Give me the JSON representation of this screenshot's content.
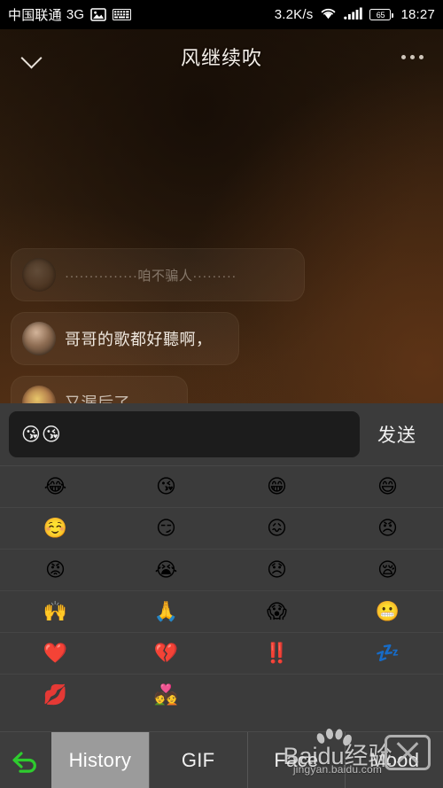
{
  "status_bar": {
    "carrier": "中国联通",
    "network": "3G",
    "image_icon": "image-icon",
    "keyboard_icon": "keyboard-icon",
    "data_speed": "3.2K/s",
    "wifi_icon": "wifi-icon",
    "signal_icon": "signal-bars-icon",
    "battery_level": "65",
    "time": "18:27"
  },
  "title_bar": {
    "collapse_icon": "chevron-down-icon",
    "song_title": "风继续吹",
    "more_icon": "more-options-icon"
  },
  "chat": {
    "messages": [
      {
        "avatar": "listener-avatar-placeholder",
        "text": "···············咱不骗人·········"
      },
      {
        "avatar": "listener-avatar-photo",
        "text": "哥哥的歌都好聽啊，"
      },
      {
        "avatar": "listener-avatar-photo-2",
        "text": "又漏后了"
      }
    ]
  },
  "keyboard": {
    "input_value": "😘😘",
    "input_placeholder": "",
    "send_label": "发送",
    "emoji_rows": [
      [
        "😂",
        "😘",
        "😁",
        "😄"
      ],
      [
        "☺️",
        "😏",
        "😖",
        "😠"
      ],
      [
        "😡",
        "😭",
        "😞",
        "😪"
      ],
      [
        "🙌",
        "🙏",
        "😱",
        "😬"
      ],
      [
        "❤️",
        "💔",
        "‼️",
        "💤"
      ],
      [
        "💋",
        "💑",
        "",
        ""
      ]
    ],
    "back_icon": "undo-back-arrow-icon",
    "back_icon_color": "#2ecc2e",
    "tabs": [
      {
        "label": "History",
        "selected": true
      },
      {
        "label": "GIF",
        "selected": false
      },
      {
        "label": "Face",
        "selected": false
      },
      {
        "label": "Mood",
        "selected": false
      }
    ]
  },
  "watermark": {
    "brand": "Baidu经验",
    "url": "jingyan.baidu.com",
    "paw_icon": "baidu-paw-icon",
    "x_icon": "x-mark-icon"
  }
}
